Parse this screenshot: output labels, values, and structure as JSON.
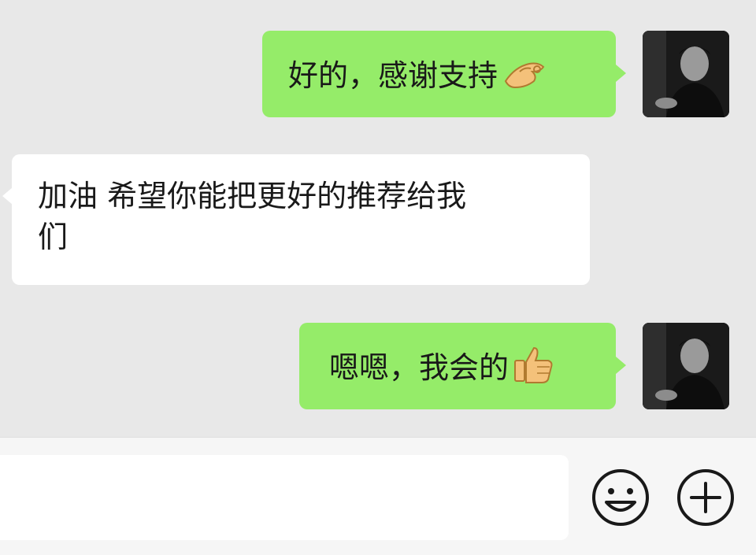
{
  "messages": [
    {
      "side": "sent",
      "text": "好的，感谢支持",
      "emoji": "ok-hand-icon"
    },
    {
      "side": "received",
      "line1": "加油 希望你能把更好的推荐给我",
      "line2": "们"
    },
    {
      "side": "sent",
      "text": "嗯嗯，我会的",
      "emoji": "thumbs-up-icon"
    }
  ],
  "input": {
    "value": "",
    "placeholder": ""
  },
  "colors": {
    "sent_bubble": "#95ec69",
    "received_bubble": "#ffffff",
    "chat_bg": "#e8e8e8"
  }
}
